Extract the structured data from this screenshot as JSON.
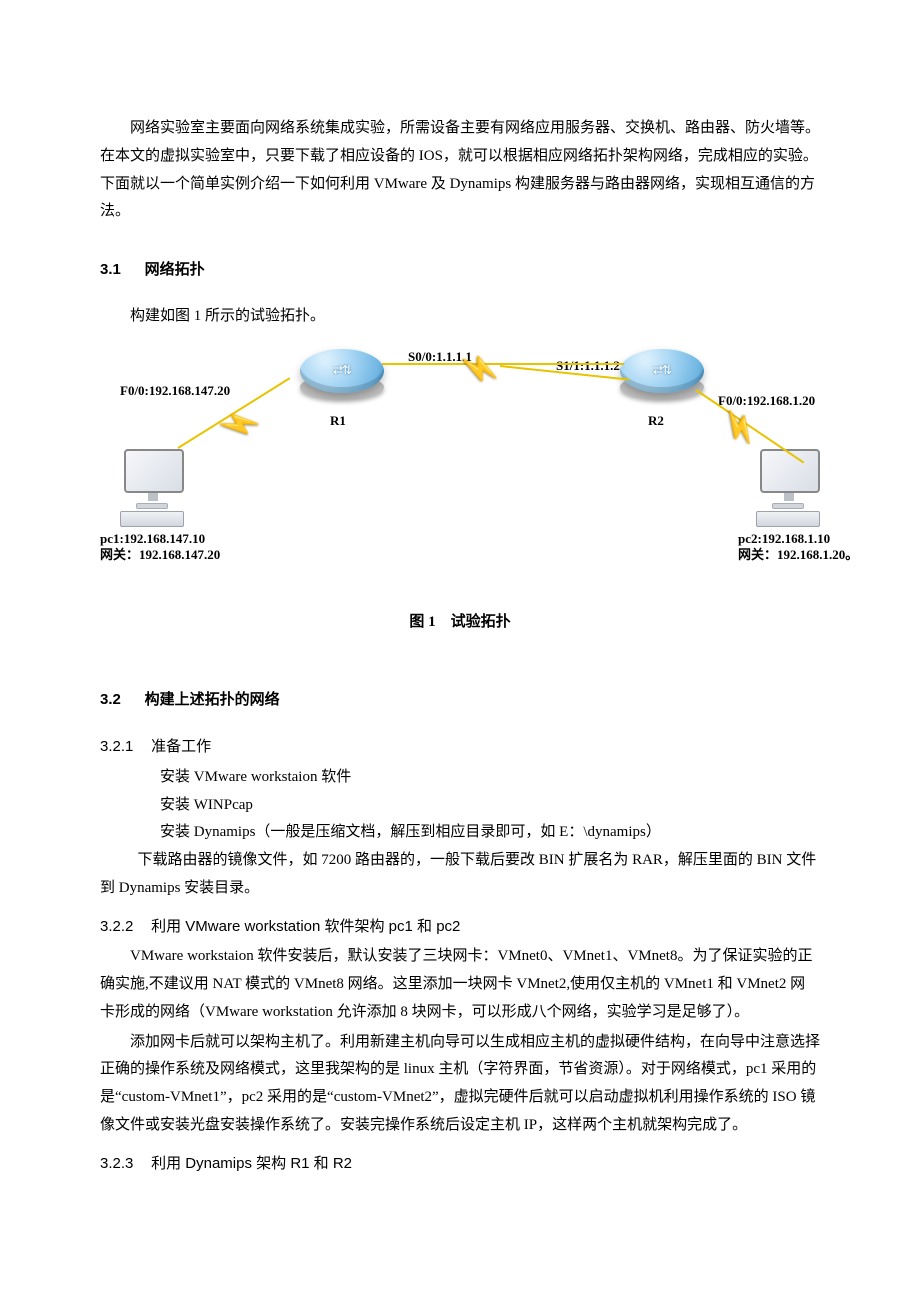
{
  "intro": "网络实验室主要面向网络系统集成实验，所需设备主要有网络应用服务器、交换机、路由器、防火墙等。在本文的虚拟实验室中，只要下载了相应设备的 IOS，就可以根据相应网络拓扑架构网络，完成相应的实验。下面就以一个简单实例介绍一下如何利用 VMware 及 Dynamips 构建服务器与路由器网络，实现相互通信的方法。",
  "s31": {
    "num": "3.1",
    "title": "网络拓扑"
  },
  "s31_p1": "构建如图 1 所示的试验拓扑。",
  "diagram": {
    "r1": {
      "name": "R1",
      "f00": "F0/0:192.168.147.20",
      "s0": "S0/0:1.1.1.1"
    },
    "r2": {
      "name": "R2",
      "f00": "F0/0:192.168.1.20",
      "s1": "S1/1:1.1.1.2"
    },
    "pc1": {
      "ip": "pc1:192.168.147.10",
      "gw": "网关：192.168.147.20"
    },
    "pc2": {
      "ip": "pc2:192.168.1.10",
      "gw": "网关：192.168.1.20。"
    },
    "caption": "图 1　试验拓扑"
  },
  "s32": {
    "num": "3.2",
    "title": "构建上述拓扑的网络"
  },
  "s321": {
    "num": "3.2.1",
    "title": "准备工作"
  },
  "prep": {
    "i1": "安装 VMware workstaion 软件",
    "i2": "安装 WINPcap",
    "i3": "安装 Dynamips（一般是压缩文档，解压到相应目录即可，如 E：\\dynamips）"
  },
  "s321_p": "下载路由器的镜像文件，如 7200 路由器的，一般下载后要改 BIN 扩展名为 RAR，解压里面的 BIN 文件到 Dynamips 安装目录。",
  "s322": {
    "num": "3.2.2",
    "title": "利用 VMware workstation 软件架构 pc1 和 pc2"
  },
  "s322_p1": "VMware workstaion 软件安装后，默认安装了三块网卡：VMnet0、VMnet1、VMnet8。为了保证实验的正确实施,不建议用 NAT 模式的 VMnet8 网络。这里添加一块网卡 VMnet2,使用仅主机的 VMnet1 和 VMnet2 网卡形成的网络（VMware workstation 允许添加 8 块网卡，可以形成八个网络，实验学习是足够了）。",
  "s322_p2": "添加网卡后就可以架构主机了。利用新建主机向导可以生成相应主机的虚拟硬件结构，在向导中注意选择正确的操作系统及网络模式，这里我架构的是 linux 主机（字符界面，节省资源）。对于网络模式，pc1 采用的是“custom-VMnet1”，pc2 采用的是“custom-VMnet2”，虚拟完硬件后就可以启动虚拟机利用操作系统的 ISO 镜像文件或安装光盘安装操作系统了。安装完操作系统后设定主机 IP，这样两个主机就架构完成了。",
  "s323": {
    "num": "3.2.3",
    "title": "利用 Dynamips 架构 R1 和 R2"
  }
}
